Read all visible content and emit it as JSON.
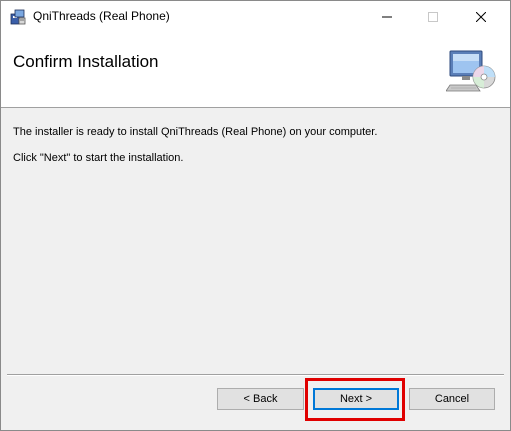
{
  "window": {
    "title": "QniThreads (Real Phone)",
    "controls": {
      "minimize_icon": "minimize-icon",
      "maximize_icon": "maximize-icon",
      "close_icon": "close-icon"
    }
  },
  "header": {
    "title": "Confirm Installation",
    "icon": "computer-with-disc-icon"
  },
  "body": {
    "line1": "The installer is ready to install QniThreads (Real Phone) on your computer.",
    "line2": "Click \"Next\" to start the installation."
  },
  "buttons": {
    "back_label": "< Back",
    "next_label": "Next >",
    "cancel_label": "Cancel"
  },
  "colors": {
    "highlight": "#e00000",
    "focus_border": "#0078d7",
    "panel_bg": "#f0f0f0"
  }
}
